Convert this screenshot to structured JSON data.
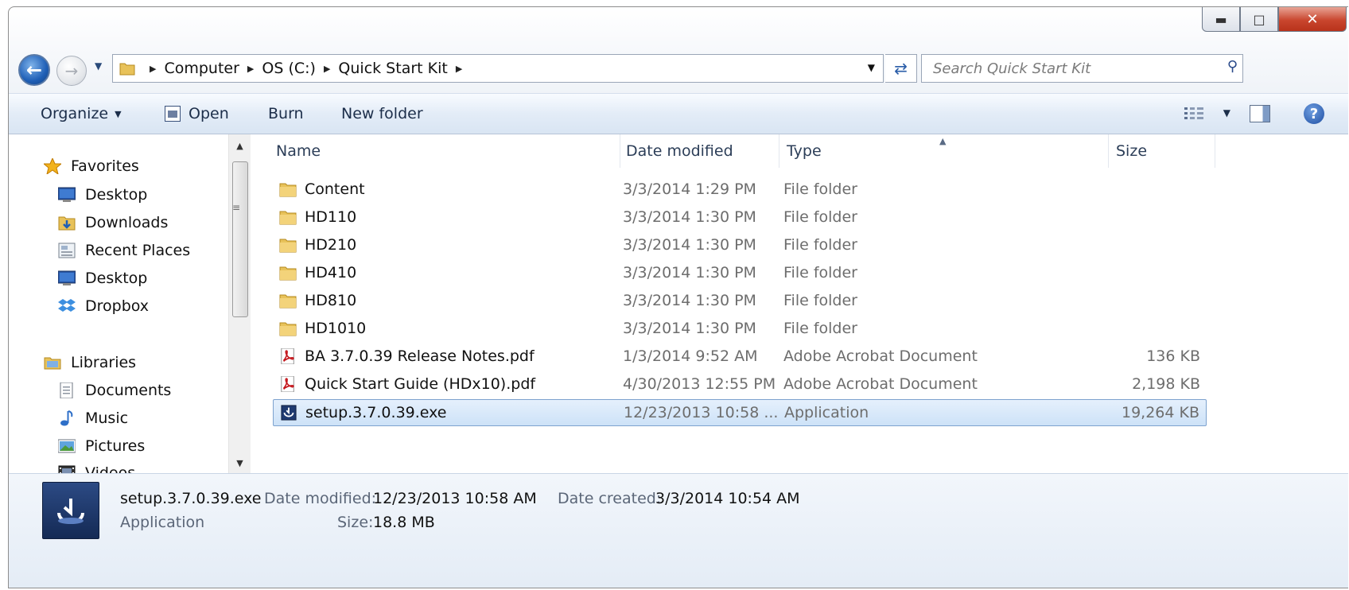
{
  "address": {
    "crumbs": [
      "Computer",
      "OS (C:)",
      "Quick Start Kit"
    ]
  },
  "search": {
    "placeholder": "Search Quick Start Kit"
  },
  "toolbar": {
    "organize": "Organize",
    "open": "Open",
    "burn": "Burn",
    "new_folder": "New folder"
  },
  "nav": {
    "items": [
      {
        "label": "Favorites",
        "icon": "star-icon"
      },
      {
        "label": "Desktop",
        "icon": "desktop-icon"
      },
      {
        "label": "Downloads",
        "icon": "downloads-icon"
      },
      {
        "label": "Recent Places",
        "icon": "recent-places-icon"
      },
      {
        "label": "Desktop",
        "icon": "desktop-icon"
      },
      {
        "label": "Dropbox",
        "icon": "dropbox-icon"
      },
      {
        "label": "Libraries",
        "icon": "libraries-icon"
      },
      {
        "label": "Documents",
        "icon": "documents-icon"
      },
      {
        "label": "Music",
        "icon": "music-icon"
      },
      {
        "label": "Pictures",
        "icon": "pictures-icon"
      },
      {
        "label": "Videos",
        "icon": "videos-icon"
      }
    ]
  },
  "columns": {
    "name": "Name",
    "date": "Date modified",
    "type": "Type",
    "size": "Size"
  },
  "files": [
    {
      "name": "Content",
      "date": "3/3/2014 1:29 PM",
      "type": "File folder",
      "size": "",
      "icon": "folder-icon"
    },
    {
      "name": "HD110",
      "date": "3/3/2014 1:30 PM",
      "type": "File folder",
      "size": "",
      "icon": "folder-icon"
    },
    {
      "name": "HD210",
      "date": "3/3/2014 1:30 PM",
      "type": "File folder",
      "size": "",
      "icon": "folder-icon"
    },
    {
      "name": "HD410",
      "date": "3/3/2014 1:30 PM",
      "type": "File folder",
      "size": "",
      "icon": "folder-icon"
    },
    {
      "name": "HD810",
      "date": "3/3/2014 1:30 PM",
      "type": "File folder",
      "size": "",
      "icon": "folder-icon"
    },
    {
      "name": "HD1010",
      "date": "3/3/2014 1:30 PM",
      "type": "File folder",
      "size": "",
      "icon": "folder-icon"
    },
    {
      "name": "BA 3.7.0.39 Release Notes.pdf",
      "date": "1/3/2014 9:52 AM",
      "type": "Adobe Acrobat Document",
      "size": "136 KB",
      "icon": "pdf-icon"
    },
    {
      "name": "Quick Start Guide (HDx10).pdf",
      "date": "4/30/2013 12:55 PM",
      "type": "Adobe Acrobat Document",
      "size": "2,198 KB",
      "icon": "pdf-icon"
    },
    {
      "name": "setup.3.7.0.39.exe",
      "date": "12/23/2013 10:58 ...",
      "type": "Application",
      "size": "19,264 KB",
      "icon": "setup-app-icon"
    }
  ],
  "details": {
    "name": "setup.3.7.0.39.exe",
    "kind": "Application",
    "date_modified_label": "Date modified:",
    "date_modified": "12/23/2013 10:58 AM",
    "date_created_label": "Date created:",
    "date_created": "3/3/2014 10:54 AM",
    "size_label": "Size:",
    "size": "18.8 MB"
  }
}
